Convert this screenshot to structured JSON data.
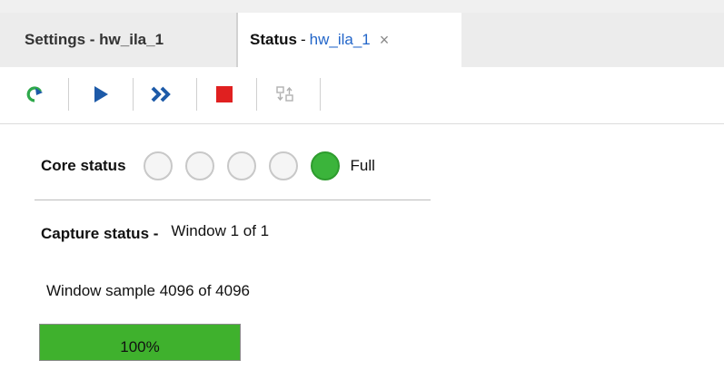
{
  "tabs": [
    {
      "label": "Settings - hw_ila_1",
      "active": false
    },
    {
      "label_bold": "Status",
      "separator": "-",
      "label_core": "hw_ila_1",
      "close": "×",
      "active": true
    }
  ],
  "toolbar": {
    "buttons": [
      {
        "icon": "refresh-icon",
        "color": "#2ea84b"
      },
      {
        "icon": "run-trigger-icon",
        "color": "#1d5aa8"
      },
      {
        "icon": "run-immediate-icon",
        "color": "#1d5aa8"
      },
      {
        "icon": "stop-icon",
        "color": "#e02020"
      },
      {
        "icon": "export-icon",
        "color": "#b0b0b0",
        "disabled": true
      }
    ]
  },
  "core_status": {
    "label": "Core status",
    "leds": [
      false,
      false,
      false,
      false,
      true
    ],
    "state": "Full",
    "led_on_color": "#3bb43b"
  },
  "capture_status": {
    "label": "Capture status -",
    "window": "Window 1 of 1"
  },
  "window_sample": "Window sample 4096 of 4096",
  "progress": {
    "value": 1.0,
    "text": "100%",
    "color": "#3fb12d"
  }
}
